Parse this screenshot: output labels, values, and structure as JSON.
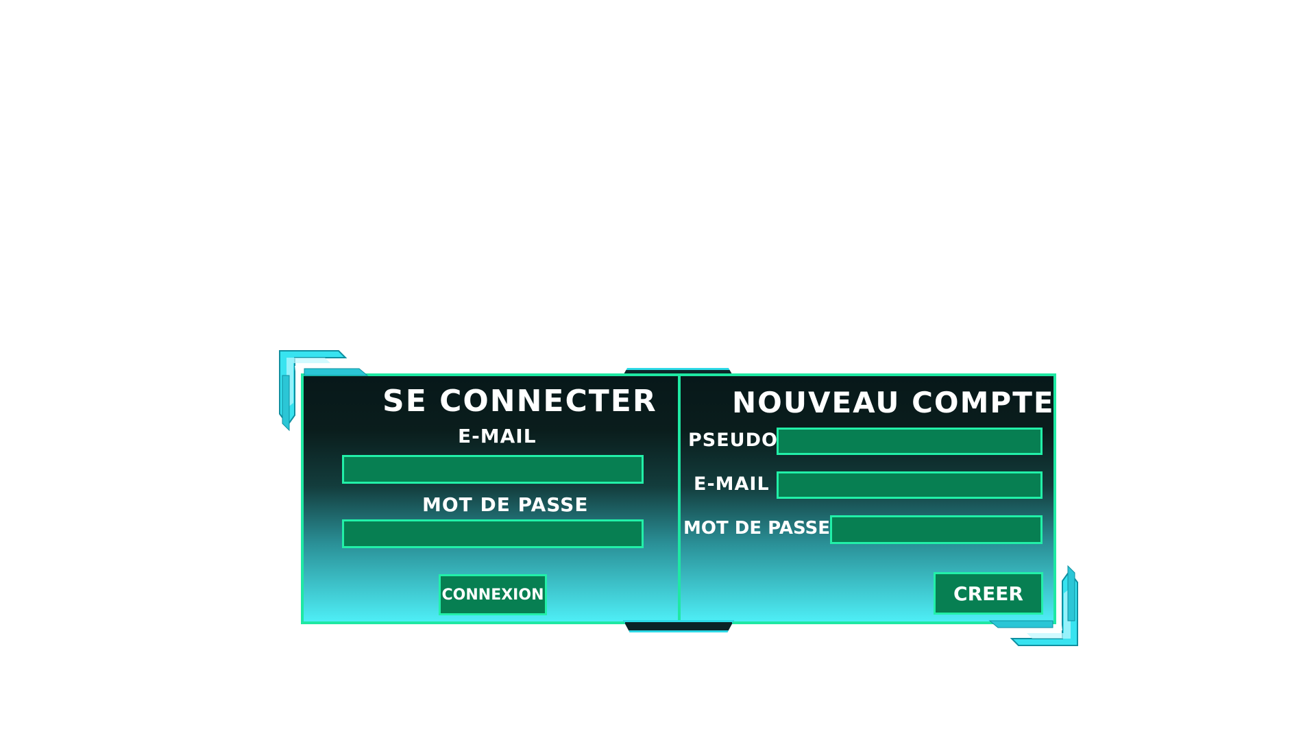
{
  "login": {
    "title": "SE CONNECTER",
    "email_label": "E-MAIL",
    "email_value": "",
    "password_label": "MOT DE PASSE",
    "password_value": "",
    "submit_label": "CONNEXION"
  },
  "register": {
    "title": "NOUVEAU COMPTE",
    "pseudo_label": "PSEUDO",
    "pseudo_value": "",
    "email_label": "E-MAIL",
    "email_value": "",
    "password_label": "MOT DE PASSE",
    "password_value": "",
    "submit_label": "CREER"
  },
  "colors": {
    "accent": "#1fe8a3",
    "field_fill": "#077f52",
    "panel_top": "#07181a",
    "panel_bottom": "#4eeef6",
    "ornament": "#2ed9e6"
  }
}
